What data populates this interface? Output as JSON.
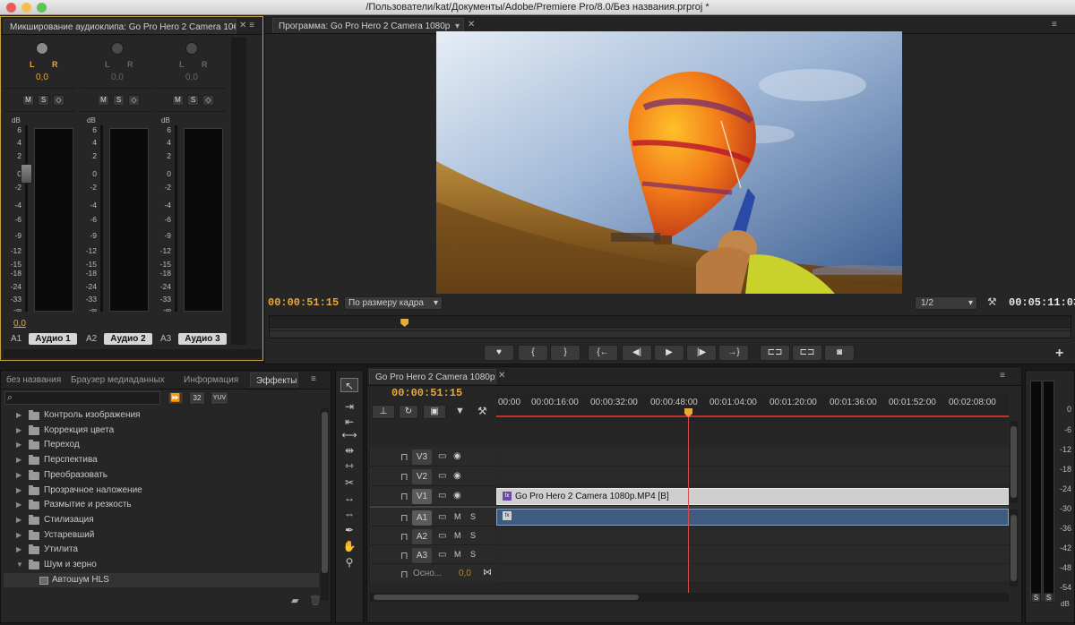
{
  "window": {
    "title": "/Пользователи/kat/Документы/Adobe/Premiere Pro/8.0/Без названия.prproj *"
  },
  "audio_mixer": {
    "tab": "Микширование аудиоклипа: Go Pro Hero 2 Camera 10€",
    "channels": [
      {
        "id": "A1",
        "name": "Аудио 1",
        "L": "L",
        "R": "R",
        "value": "0,0"
      },
      {
        "id": "A2",
        "name": "Аудио 2",
        "L": "L",
        "R": "R",
        "value": "0,0"
      },
      {
        "id": "A3",
        "name": "Аудио 3",
        "L": "L",
        "R": "R",
        "value": "0,0"
      }
    ],
    "buttons": {
      "mute": "M",
      "solo": "S",
      "vo": "◇"
    },
    "db_label": "dB",
    "scale": [
      "6",
      "4",
      "2",
      "0",
      "-2",
      "-4",
      "-6",
      "-9",
      "-12",
      "-15",
      "-18",
      "-24",
      "-33",
      "-∞"
    ],
    "master_value": "0,0"
  },
  "program": {
    "tab": "Программа: Go Pro Hero 2 Camera 1080p",
    "current_time": "00:00:51:15",
    "zoom": "По размеру кадра",
    "resolution": "1/2",
    "duration": "00:05:11:03",
    "playhead_fraction": 0.168,
    "controls": [
      "marker-icon",
      "in-point-icon",
      "out-point-icon",
      "go-to-in-icon",
      "step-back-icon",
      "play-icon",
      "step-forward-icon",
      "go-to-out-icon",
      "lift-icon",
      "extract-icon",
      "export-frame-icon"
    ],
    "glyphs": {
      "marker": "♥",
      "in": "{",
      "out": "}",
      "goin": "{←",
      "back": "◀|",
      "play": "▶",
      "fwd": "|▶",
      "goout": "→}",
      "lift": "⊏⊐",
      "extract": "⊏⊐",
      "camera": "◙",
      "plus": "+",
      "wrench": "🔧"
    }
  },
  "effects": {
    "tabs": [
      "без названия",
      "Браузер медиаданных",
      "Информация",
      "Эффекты"
    ],
    "active_tab": "Эффекты",
    "buttons": {
      "accel": "⏩",
      "b32": "32",
      "yuv": "YUV"
    },
    "items": [
      {
        "label": "Контроль изображения",
        "expanded": false
      },
      {
        "label": "Коррекция цвета",
        "expanded": false
      },
      {
        "label": "Переход",
        "expanded": false
      },
      {
        "label": "Перспектива",
        "expanded": false
      },
      {
        "label": "Преобразовать",
        "expanded": false
      },
      {
        "label": "Прозрачное наложение",
        "expanded": false
      },
      {
        "label": "Размытие и резкость",
        "expanded": false
      },
      {
        "label": "Стилизация",
        "expanded": false
      },
      {
        "label": "Устаревший",
        "expanded": false
      },
      {
        "label": "Утилита",
        "expanded": false
      },
      {
        "label": "Шум и зерно",
        "expanded": true
      }
    ],
    "child": "Автошум HLS"
  },
  "timeline": {
    "tab": "Go Pro Hero 2 Camera 1080p",
    "current_time": "00:00:51:15",
    "ruler": [
      "00:00",
      "00:00:16:00",
      "00:00:32:00",
      "00:00:48:00",
      "00:01:04:00",
      "00:01:20:00",
      "00:01:36:00",
      "00:01:52:00",
      "00:02:08:00"
    ],
    "video_tracks": [
      "V3",
      "V2",
      "V1"
    ],
    "audio_tracks": [
      "A1",
      "A2",
      "A3"
    ],
    "master": {
      "label": "Осно...",
      "value": "0,0"
    },
    "clip_video": "Go Pro Hero 2 Camera 1080p.MP4 [B]",
    "clip_audio_fx": "fx",
    "buttons": {
      "m": "M",
      "s": "S",
      "fx": "fx"
    }
  },
  "master_meter": {
    "scale": [
      "0",
      "-6",
      "-12",
      "-18",
      "-24",
      "-30",
      "-36",
      "-42",
      "-48",
      "-54"
    ],
    "db": "dB",
    "solo": "S"
  },
  "colors": {
    "accent": "#e8a93a",
    "clip_video": "#c9c9c9",
    "clip_audio": "#3f5c80",
    "playhead": "#d94a4a"
  }
}
